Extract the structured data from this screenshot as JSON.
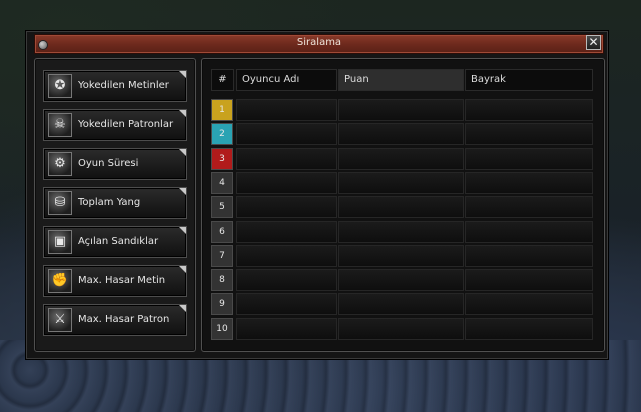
{
  "window": {
    "title": "Siralama",
    "close_label": "✕"
  },
  "categories": [
    {
      "label": "Yokedilen Metinler",
      "icon": "pentagram-icon",
      "glyph": "✪"
    },
    {
      "label": "Yokedilen Patronlar",
      "icon": "skull-icon",
      "glyph": "☠"
    },
    {
      "label": "Oyun Süresi",
      "icon": "gear-clock-icon",
      "glyph": "⚙"
    },
    {
      "label": "Toplam Yang",
      "icon": "coins-icon",
      "glyph": "⛁"
    },
    {
      "label": "Açılan Sandıklar",
      "icon": "chest-icon",
      "glyph": "▣"
    },
    {
      "label": "Max. Hasar Metin",
      "icon": "fist-icon",
      "glyph": "✊"
    },
    {
      "label": "Max. Hasar Patron",
      "icon": "sword-icon",
      "glyph": "⚔"
    }
  ],
  "table": {
    "headers": {
      "rank": "#",
      "name": "Oyuncu Adı",
      "score": "Puan",
      "flag": "Bayrak"
    },
    "rows": [
      {
        "rank": "1",
        "color": "#c9a21e"
      },
      {
        "rank": "2",
        "color": "#2aa3b3"
      },
      {
        "rank": "3",
        "color": "#b11b1b"
      },
      {
        "rank": "4",
        "color": "#333333"
      },
      {
        "rank": "5",
        "color": "#333333"
      },
      {
        "rank": "6",
        "color": "#333333"
      },
      {
        "rank": "7",
        "color": "#333333"
      },
      {
        "rank": "8",
        "color": "#333333"
      },
      {
        "rank": "9",
        "color": "#333333"
      },
      {
        "rank": "10",
        "color": "#333333"
      }
    ]
  }
}
